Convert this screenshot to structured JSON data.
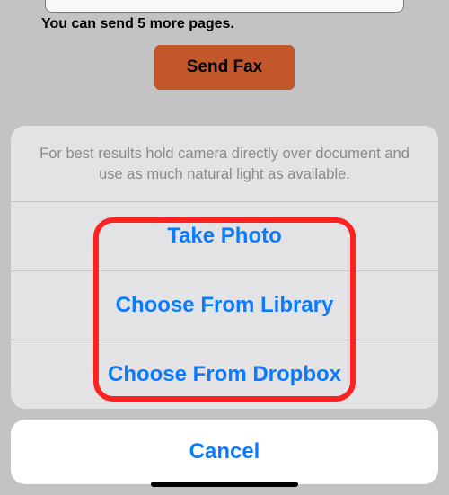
{
  "background": {
    "quota_text": "You can send 5 more pages.",
    "send_fax_label": "Send Fax"
  },
  "sheet": {
    "header_text": "For best results hold camera directly over document and use as much natural light as available.",
    "options": {
      "take_photo": "Take Photo",
      "choose_library": "Choose From Library",
      "choose_dropbox": "Choose From Dropbox"
    },
    "cancel_label": "Cancel"
  }
}
